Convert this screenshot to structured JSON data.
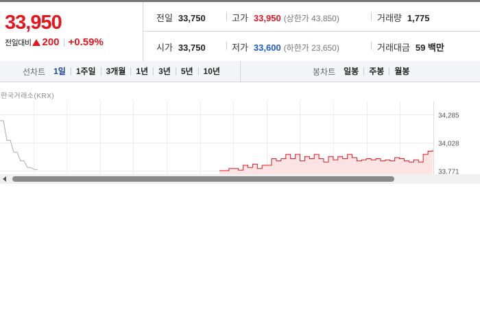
{
  "quote": {
    "current_price": "33,950",
    "change_label": "전일대비",
    "change_amount": "200",
    "change_percent": "+0.59%"
  },
  "stats": {
    "prev_close": {
      "label": "전일",
      "value": "33,750"
    },
    "high": {
      "label": "고가",
      "value": "33,950",
      "limit_label": "(상한가 43,850)"
    },
    "volume": {
      "label": "거래량",
      "value": "1,775"
    },
    "open": {
      "label": "시가",
      "value": "33,750"
    },
    "low": {
      "label": "저가",
      "value": "33,600",
      "limit_label": "(하한가 23,650)"
    },
    "turnover": {
      "label": "거래대금",
      "value": "59 백만"
    }
  },
  "line_tabs": {
    "title": "선차트",
    "items": [
      "1일",
      "1주일",
      "3개월",
      "1년",
      "3년",
      "5년",
      "10년"
    ],
    "active": "1일"
  },
  "candle_tabs": {
    "title": "봉차트",
    "items": [
      "일봉",
      "주봉",
      "월봉"
    ]
  },
  "chart": {
    "source": "한국거래소(KRX)",
    "colors": {
      "current_day": "#e8141c",
      "previous_day": "#aaaaaa",
      "fill": "#fce4e4"
    }
  },
  "chart_data": {
    "type": "area",
    "title": "",
    "xlabel": "",
    "ylabel": "",
    "y_ticks": [
      "34,285",
      "34,028",
      "33,771"
    ],
    "ylim": [
      33700,
      34350
    ],
    "grid": true,
    "series": [
      {
        "values": [
          34230,
          34230,
          34050,
          34050,
          33940,
          33940,
          33860,
          33860,
          33800,
          33800,
          33780,
          33780
        ]
      },
      {
        "values": [
          33770,
          33770,
          33790,
          33790,
          33775,
          33820,
          33800,
          33830,
          33790,
          33820,
          33820,
          33880,
          33860,
          33880,
          33920,
          33880,
          33920,
          33860,
          33900,
          33880,
          33920,
          33880,
          33850,
          33900,
          33870,
          33900,
          33880,
          33920,
          33890,
          33860,
          33870,
          33880,
          33870,
          33880,
          33860,
          33870,
          33860,
          33890,
          33880,
          33860,
          33850,
          33870,
          33850,
          33920,
          33950,
          33960
        ]
      }
    ]
  }
}
